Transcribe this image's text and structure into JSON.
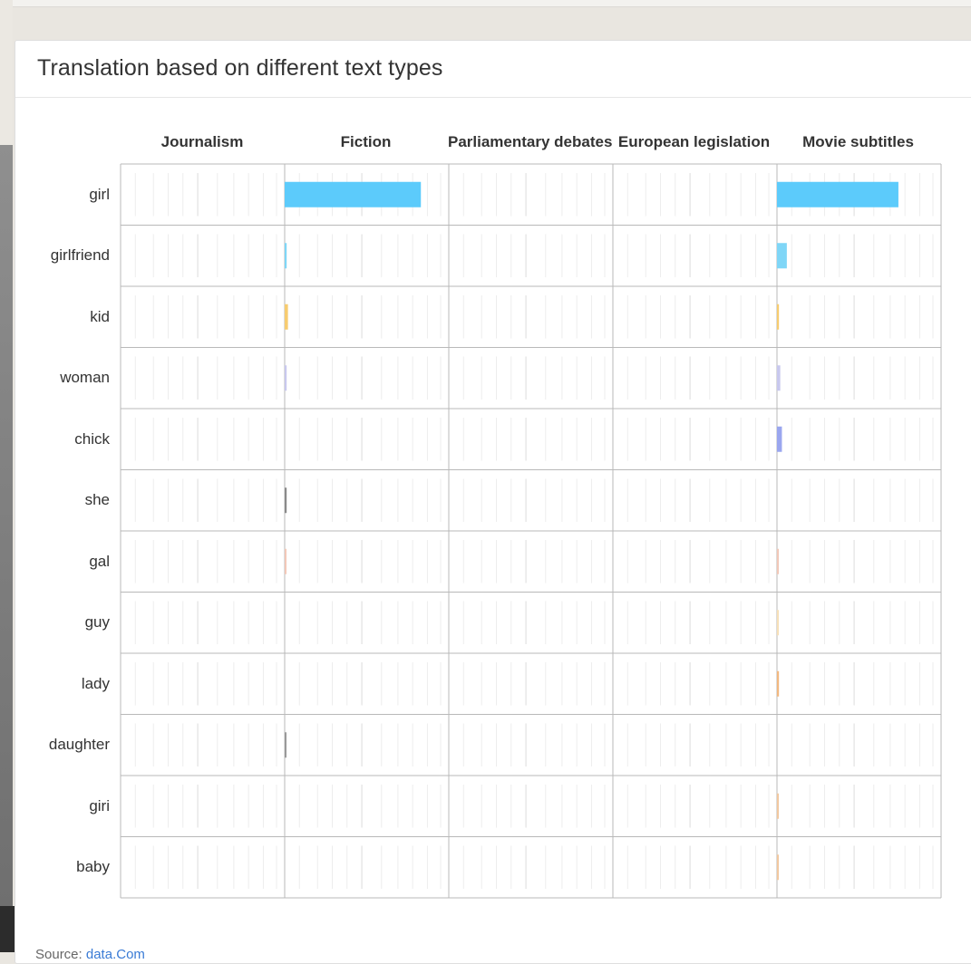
{
  "title": "Translation based on different text types",
  "columns": [
    "Journalism",
    "Fiction",
    "Parliamentary debates",
    "European legislation",
    "Movie subtitles"
  ],
  "rows": [
    "girl",
    "girlfriend",
    "kid",
    "woman",
    "chick",
    "she",
    "gal",
    "guy",
    "lady",
    "daughter",
    "giri",
    "baby"
  ],
  "source_prefix": "Source: ",
  "source_link": "data.Com",
  "colors": {
    "girl": "#5ccbfb",
    "girlfriend": "#7fd6f7",
    "kid": "#f7cc70",
    "woman": "#c8c8ee",
    "chick": "#9aa6ef",
    "she": "#8a8a8a",
    "gal": "#f2c8b8",
    "guy": "#f7e0b8",
    "lady": "#f2b880",
    "daughter": "#9a9a9a",
    "giri": "#f2c8a0",
    "baby": "#f2c8a0"
  },
  "chart_data": {
    "type": "bar",
    "categories": [
      "girl",
      "girlfriend",
      "kid",
      "woman",
      "chick",
      "she",
      "gal",
      "guy",
      "lady",
      "daughter",
      "giri",
      "baby"
    ],
    "xmax": 1.0,
    "series": [
      {
        "name": "Journalism",
        "values": [
          0,
          0,
          0,
          0,
          0,
          0,
          0,
          0,
          0,
          0,
          0,
          0
        ]
      },
      {
        "name": "Fiction",
        "values": [
          0.83,
          0.012,
          0.02,
          0.012,
          0,
          0.012,
          0.008,
          0,
          0,
          0.006,
          0,
          0
        ]
      },
      {
        "name": "Parliamentary debates",
        "values": [
          0,
          0,
          0,
          0,
          0,
          0,
          0,
          0,
          0,
          0,
          0,
          0
        ]
      },
      {
        "name": "European legislation",
        "values": [
          0,
          0,
          0,
          0,
          0,
          0,
          0,
          0,
          0,
          0,
          0,
          0
        ]
      },
      {
        "name": "Movie subtitles",
        "values": [
          0.74,
          0.06,
          0.012,
          0.02,
          0.03,
          0,
          0.008,
          0.006,
          0.012,
          0,
          0.006,
          0.006
        ]
      }
    ]
  }
}
